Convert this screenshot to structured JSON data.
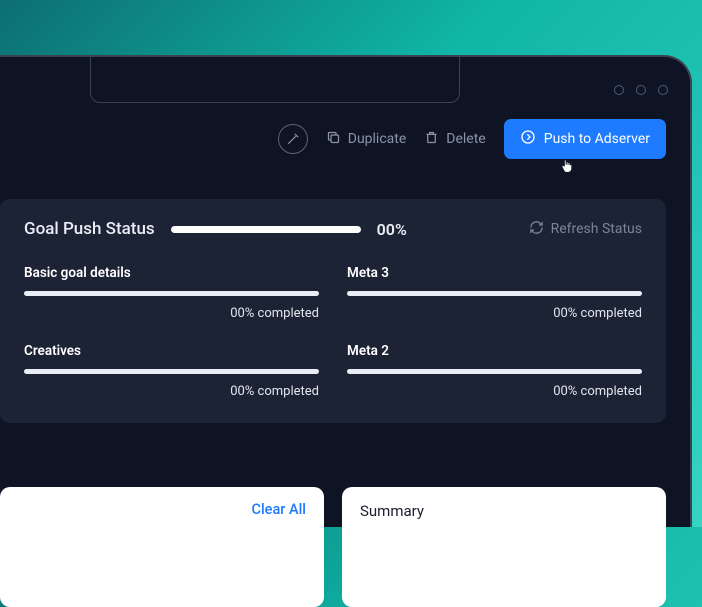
{
  "toolbar": {
    "duplicate_label": "Duplicate",
    "delete_label": "Delete",
    "push_label": "Push to Adserver"
  },
  "status_panel": {
    "title": "Goal Push Status",
    "overall_percent": "00%",
    "refresh_label": "Refresh Status",
    "items": [
      {
        "title": "Basic goal details",
        "completed_text": "00% completed"
      },
      {
        "title": "Meta 3",
        "completed_text": "00% completed"
      },
      {
        "title": "Creatives",
        "completed_text": "00% completed"
      },
      {
        "title": "Meta 2",
        "completed_text": "00% completed"
      }
    ]
  },
  "bottom": {
    "clear_all_label": "Clear All",
    "summary_title": "Summary"
  },
  "colors": {
    "accent": "#1e7bff",
    "panel": "#1c2335",
    "bg": "#0e1424"
  }
}
